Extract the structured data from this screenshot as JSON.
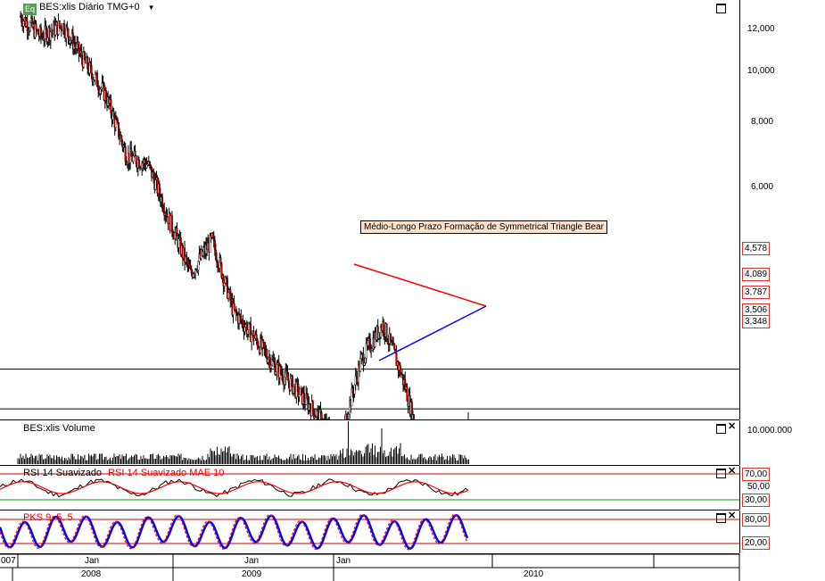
{
  "header": {
    "badge": "Eq",
    "title": "BES:xlis Diário TMG+0",
    "dropdown_icon": "chevron-down-icon"
  },
  "annotation": "Médio-Longo Prazo Formação de Symmetrical Triangle Bear",
  "price_axis": {
    "ticks": [
      "12,000",
      "10,000",
      "8,000",
      "6,000"
    ],
    "levels": [
      "4,578",
      "4,089",
      "3,787",
      "3,506",
      "3,348"
    ]
  },
  "volume_panel": {
    "title": "BES:xlis Volume",
    "axis_label": "10.000.000"
  },
  "rsi_panel": {
    "title": "RSI 14 Suavizado",
    "title2": "RSI 14 Suavizado MAE 10",
    "levels": [
      "70,00",
      "50,00",
      "30,00"
    ]
  },
  "pks_panel": {
    "title": "PKS 9, 5, 5",
    "levels": [
      "80,00",
      "20,00"
    ]
  },
  "time_axis": {
    "row1": [
      "007",
      "Jan",
      "Jan",
      "Jan"
    ],
    "row2": [
      "2008",
      "2009",
      "2010"
    ]
  },
  "colors": {
    "resistance": "#ff0000",
    "support": "#0000ff",
    "rsi": "#ff0000",
    "pks_fast": "#ff0000",
    "pks_slow": "#0000ff"
  },
  "chart_data": {
    "type": "line",
    "title": "BES:xlis Diário TMG+0",
    "scale": "log",
    "ylim": [
      2.8,
      13.0
    ],
    "x": [
      "2007-12",
      "2008-01",
      "2008-02",
      "2008-03",
      "2008-04",
      "2008-05",
      "2008-06",
      "2008-07",
      "2008-08",
      "2008-09",
      "2008-10",
      "2008-11",
      "2008-12",
      "2009-01",
      "2009-02",
      "2009-03",
      "2009-04",
      "2009-05",
      "2009-06",
      "2009-07",
      "2009-08",
      "2009-09"
    ],
    "series": [
      {
        "values": [
          12.5,
          11.8,
          12.2,
          11.0,
          10.0,
          8.4,
          8.2,
          7.0,
          6.0,
          6.6,
          5.4,
          5.0,
          4.6,
          4.3,
          4.0,
          3.7,
          4.7,
          5.2,
          4.4,
          3.4,
          3.7,
          3.9
        ]
      }
    ],
    "levels": [
      4.578,
      4.089,
      3.787,
      3.506,
      3.348
    ]
  }
}
